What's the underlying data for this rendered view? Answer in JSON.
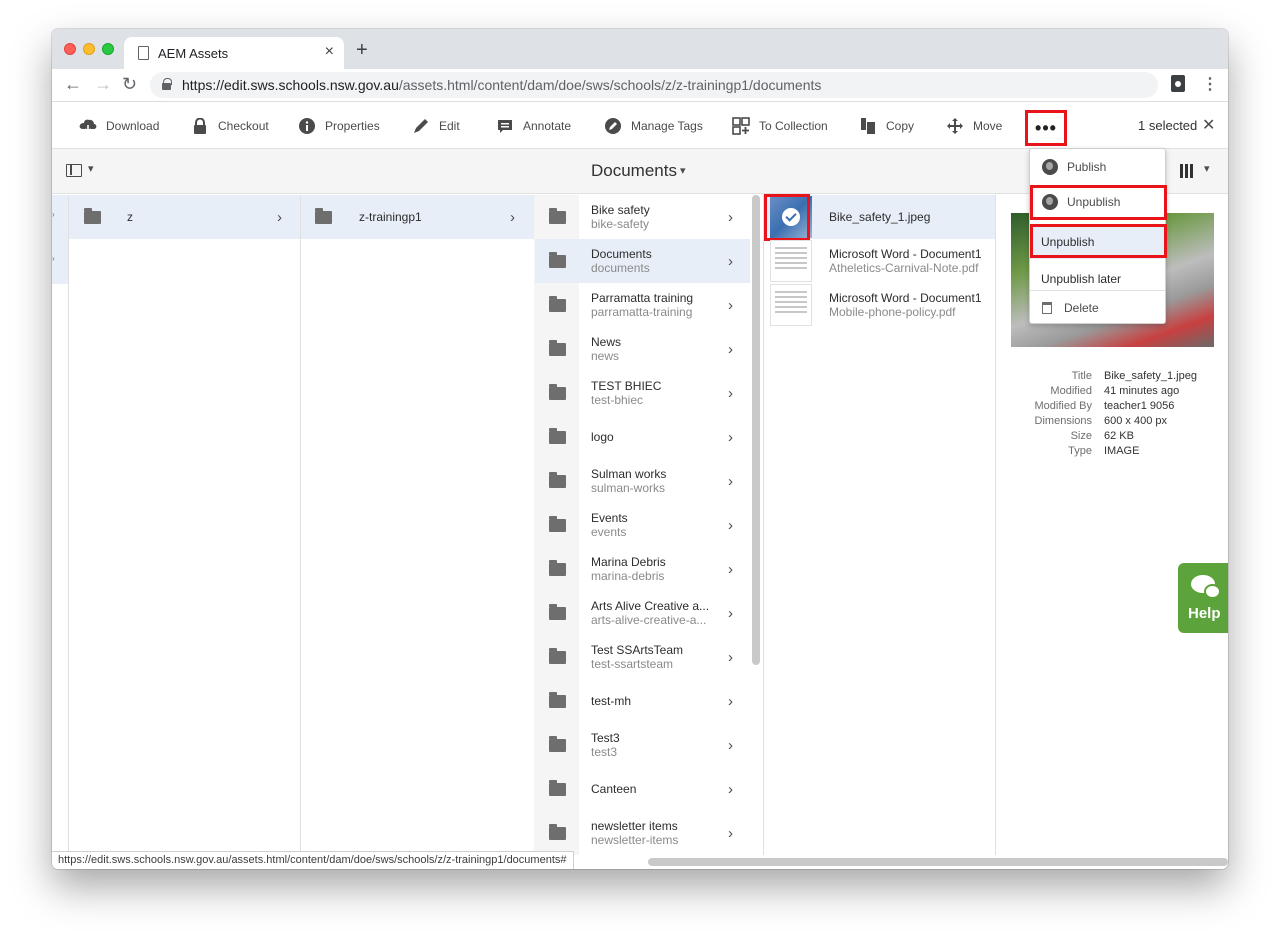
{
  "browser": {
    "tab_title": "AEM Assets",
    "tab_close": "×",
    "new_tab": "+",
    "url_host": "https://edit.sws.schools.nsw.gov.au",
    "url_path": "/assets.html/content/dam/doe/sws/schools/z/z-trainingp1/documents",
    "status_url": "https://edit.sws.schools.nsw.gov.au/assets.html/content/dam/doe/sws/schools/z/z-trainingp1/documents#"
  },
  "actions": [
    {
      "label": "Download",
      "icon": "download-icon"
    },
    {
      "label": "Checkout",
      "icon": "lock-icon"
    },
    {
      "label": "Properties",
      "icon": "info-icon"
    },
    {
      "label": "Edit",
      "icon": "pencil-icon"
    },
    {
      "label": "Annotate",
      "icon": "comment-icon"
    },
    {
      "label": "Manage Tags",
      "icon": "tag-icon"
    },
    {
      "label": "To Collection",
      "icon": "collection-icon"
    },
    {
      "label": "Copy",
      "icon": "copy-icon"
    },
    {
      "label": "Move",
      "icon": "move-icon"
    }
  ],
  "more_label": "•••",
  "selection": {
    "count_text": "1 selected",
    "close": "✕"
  },
  "title_bar": {
    "title": "Documents",
    "chevron": "⌄"
  },
  "col1": [
    {
      "title": "z"
    }
  ],
  "col2": [
    {
      "title": "z-trainingp1"
    }
  ],
  "folders": [
    {
      "title": "Bike safety",
      "name": "bike-safety"
    },
    {
      "title": "Documents",
      "name": "documents"
    },
    {
      "title": "Parramatta training",
      "name": "parramatta-training"
    },
    {
      "title": "News",
      "name": "news"
    },
    {
      "title": "TEST BHIEC",
      "name": "test-bhiec"
    },
    {
      "title": "logo",
      "name": ""
    },
    {
      "title": "Sulman works",
      "name": "sulman-works"
    },
    {
      "title": "Events",
      "name": "events"
    },
    {
      "title": "Marina Debris",
      "name": "marina-debris"
    },
    {
      "title": "Arts Alive Creative a...",
      "name": "arts-alive-creative-a..."
    },
    {
      "title": "Test SSArtsTeam",
      "name": "test-ssartsteam"
    },
    {
      "title": "test-mh",
      "name": ""
    },
    {
      "title": "Test3",
      "name": "test3"
    },
    {
      "title": "Canteen",
      "name": ""
    },
    {
      "title": "newsletter items",
      "name": "newsletter-items"
    }
  ],
  "assets": [
    {
      "title": "Bike_safety_1.jpeg",
      "name": ""
    },
    {
      "title": "Microsoft Word - Document1",
      "name": "Atheletics-Carnival-Note.pdf"
    },
    {
      "title": "Microsoft Word - Document1",
      "name": "Mobile-phone-policy.pdf"
    }
  ],
  "popover": {
    "publish": "Publish",
    "unpublish": "Unpublish",
    "sub_unpublish": "Unpublish",
    "sub_unpublish_later": "Unpublish later",
    "delete": "Delete"
  },
  "metadata": [
    {
      "key": "Title",
      "value": "Bike_safety_1.jpeg"
    },
    {
      "key": "Modified",
      "value": "41 minutes ago"
    },
    {
      "key": "Modified By",
      "value": "teacher1 9056"
    },
    {
      "key": "Dimensions",
      "value": "600 x 400 px"
    },
    {
      "key": "Size",
      "value": "62 KB"
    },
    {
      "key": "Type",
      "value": "IMAGE"
    }
  ],
  "help": {
    "label": "Help"
  },
  "colors": {
    "highlight_red": "#e8141a",
    "help_green": "#5da33b",
    "selection_bg": "#e8eef8"
  }
}
